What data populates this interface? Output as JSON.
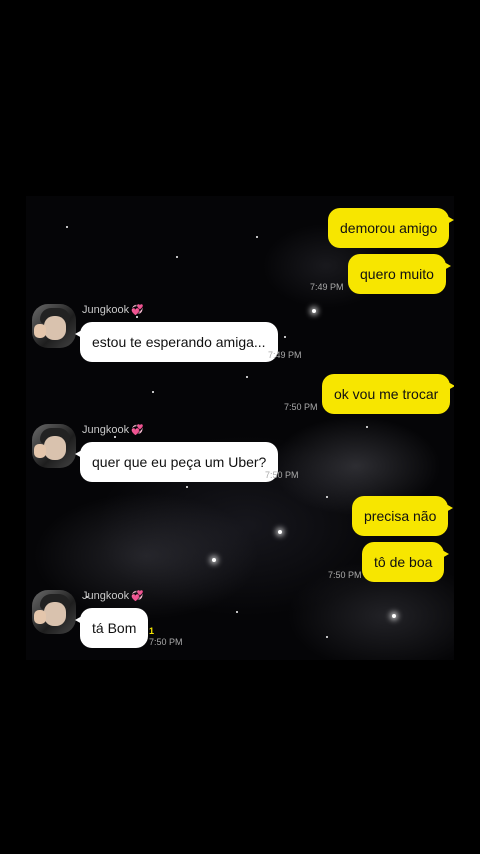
{
  "contact": {
    "name": "Jungkook",
    "emoji": "💞"
  },
  "colors": {
    "outgoing_bubble": "#f7e600",
    "incoming_bubble": "#ffffff",
    "background": "#000000",
    "unread": "#f7e600"
  },
  "messages": [
    {
      "direction": "out",
      "text": "demorou amigo"
    },
    {
      "direction": "out",
      "text": "quero muito",
      "time": "7:49 PM"
    },
    {
      "direction": "in",
      "sender": "Jungkook",
      "text": "estou te esperando amiga...",
      "time": "7:49 PM"
    },
    {
      "direction": "out",
      "text": "ok vou me trocar",
      "time": "7:50 PM"
    },
    {
      "direction": "in",
      "sender": "Jungkook",
      "text": "quer que eu peça um Uber?",
      "time": "7:50 PM"
    },
    {
      "direction": "out",
      "text": "precisa não"
    },
    {
      "direction": "out",
      "text": "tô de boa",
      "time": "7:50 PM"
    },
    {
      "direction": "in",
      "sender": "Jungkook",
      "text": "tá Bom",
      "time": "7:50 PM",
      "unread": "1"
    }
  ]
}
